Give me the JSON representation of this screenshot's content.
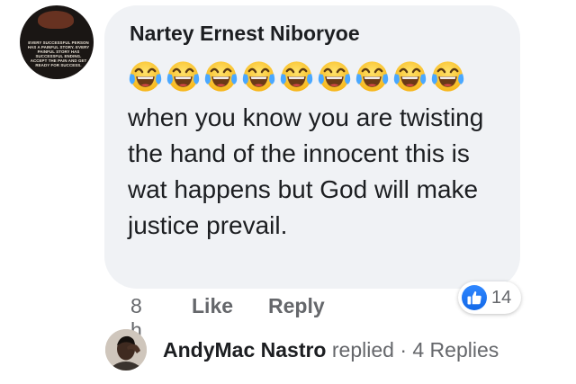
{
  "comment": {
    "author": "Nartey Ernest Niboryoe",
    "avatar_icon": "profile-quote-avatar",
    "avatar_text": "EVERY SUCCESSFUL PERSON HAS A PAINFUL STORY. EVERY PAINFUL STORY HAS SUCCESSFUL ENDING. ACCEPT THE PAIN AND GET READY FOR SUCCESS.",
    "emoji_icon": "laughing-tears-emoji",
    "emoji_count": 9,
    "text": "when you know you are twisting the hand of the innocent this is wat happens but God will make justice prevail.",
    "bubble_color": "#f0f2f5"
  },
  "actions": {
    "time": "8 h",
    "like_label": "Like",
    "reply_label": "Reply"
  },
  "reactions": {
    "icon": "thumbs-up-icon",
    "count": "14",
    "color": "#1877f2"
  },
  "replies": {
    "avatar_icon": "user-avatar-andymac",
    "name": "AndyMac Nastro",
    "action": "replied",
    "separator": "·",
    "count_label": "4 Replies"
  }
}
